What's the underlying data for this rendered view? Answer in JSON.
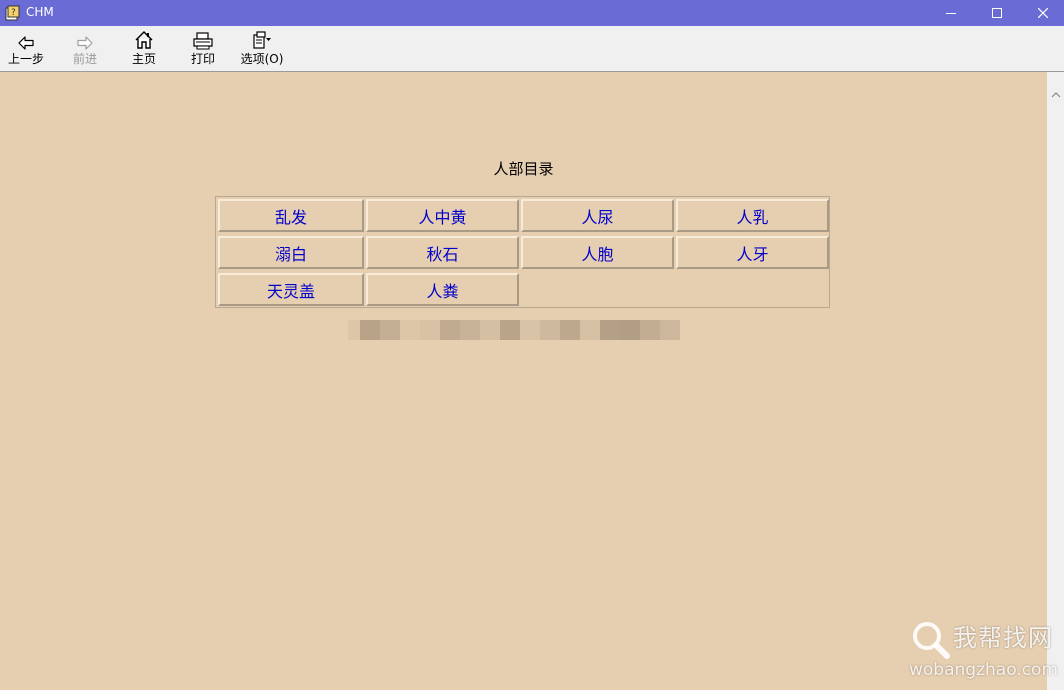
{
  "window": {
    "title": "CHM",
    "controls": [
      "minimize-icon",
      "maximize-icon",
      "close-icon"
    ]
  },
  "toolbar": {
    "back_label": "上一步",
    "forward_label": "前进",
    "home_label": "主页",
    "print_label": "打印",
    "options_label": "选项(O)"
  },
  "page": {
    "heading": "人部目录",
    "toc": [
      [
        "乱发",
        "人中黄",
        "人尿",
        "人乳"
      ],
      [
        "溺白",
        "秋石",
        "人胞",
        "人牙"
      ],
      [
        "天灵盖",
        "人粪"
      ]
    ],
    "link_color": "#0000cc",
    "background_color": "#e6ceb0"
  },
  "watermark": {
    "name": "我帮找网",
    "site": "wobangzhao.com"
  }
}
